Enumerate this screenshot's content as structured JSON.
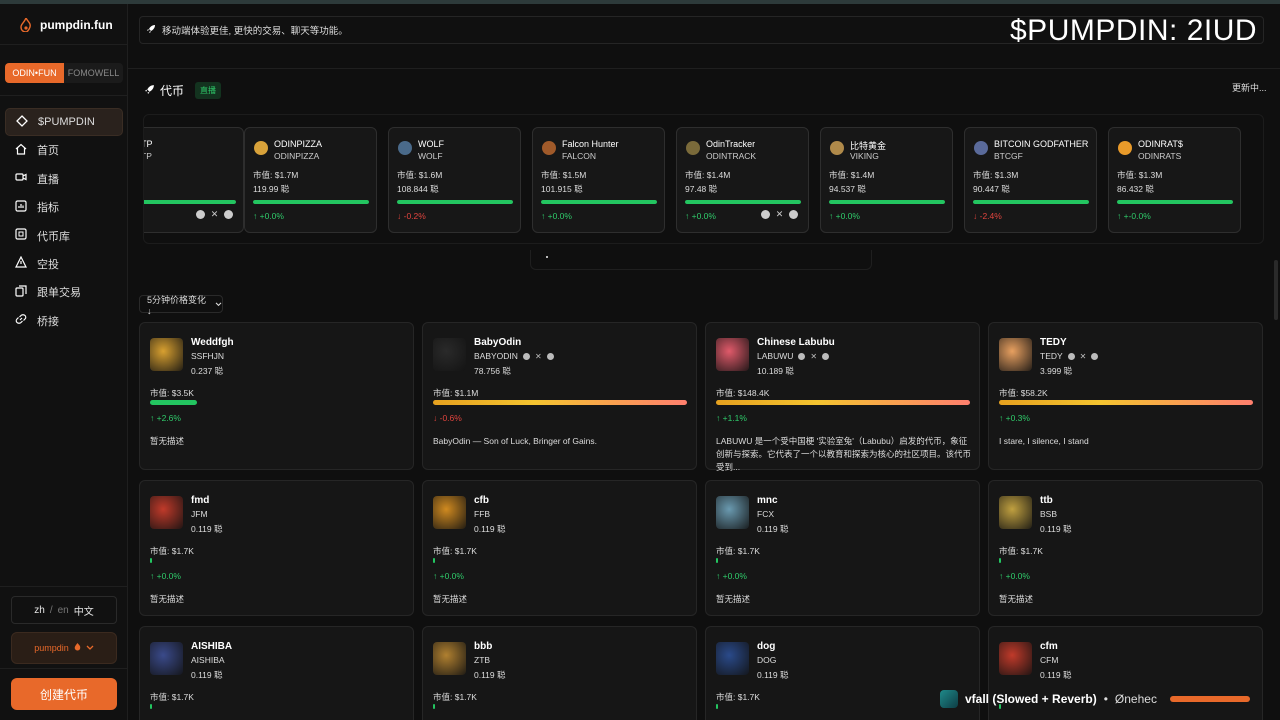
{
  "app": {
    "name": "pumpdin.fun"
  },
  "switcher": {
    "active": "ODIN•FUN",
    "inactive": "FOMOWELL"
  },
  "nav": [
    {
      "label": "$PUMPDIN",
      "icon": "diamond-icon",
      "active": true
    },
    {
      "label": "首页",
      "icon": "home-icon"
    },
    {
      "label": "直播",
      "icon": "video-icon"
    },
    {
      "label": "指标",
      "icon": "chart-icon"
    },
    {
      "label": "代币库",
      "icon": "library-icon"
    },
    {
      "label": "空投",
      "icon": "airdrop-icon"
    },
    {
      "label": "跟单交易",
      "icon": "copy-trade-icon"
    },
    {
      "label": "桥接",
      "icon": "link-icon"
    }
  ],
  "lang": {
    "zh": "zh",
    "slash": "/",
    "en": "en",
    "label": "中文"
  },
  "user": {
    "name": "pumpdin"
  },
  "create_button": "创建代币",
  "banner": {
    "text": "移动端体验更佳, 更快的交易、聊天等功能。"
  },
  "watermark": "$PUMPDIN: 2IUD",
  "tokens_section": {
    "title": "代币",
    "live": "直播",
    "updating": "更新中..."
  },
  "ticker": [
    {
      "name": "TP",
      "sym": "TP",
      "cap": "M",
      "count": "",
      "change": "",
      "dir": "up",
      "bar": 1.0,
      "socials": true,
      "color": "#777"
    },
    {
      "name": "ODINPIZZA",
      "sym": "ODINPIZZA",
      "cap": "市值: $1.7M",
      "count": "119.99 聪",
      "change": "↑ +0.0%",
      "dir": "up",
      "bar": 1.0,
      "socials": false,
      "color": "#d8a23a"
    },
    {
      "name": "WOLF",
      "sym": "WOLF",
      "cap": "市值: $1.6M",
      "count": "108.844 聪",
      "change": "↓ -0.2%",
      "dir": "down",
      "bar": 1.0,
      "socials": false,
      "color": "#4a6a8a"
    },
    {
      "name": "Falcon Hunter",
      "sym": "FALCON",
      "cap": "市值: $1.5M",
      "count": "101.915 聪",
      "change": "↑ +0.0%",
      "dir": "up",
      "bar": 1.0,
      "socials": false,
      "color": "#a05a2a"
    },
    {
      "name": "OdinTracker",
      "sym": "ODINTRACK",
      "cap": "市值: $1.4M",
      "count": "97.48 聪",
      "change": "↑ +0.0%",
      "dir": "up",
      "bar": 1.0,
      "socials": true,
      "color": "#7a6a3a"
    },
    {
      "name": "比特黄金",
      "sym": "VIKING",
      "cap": "市值: $1.4M",
      "count": "94.537 聪",
      "change": "↑ +0.0%",
      "dir": "up",
      "bar": 1.0,
      "socials": false,
      "color": "#b08a4a"
    },
    {
      "name": "BITCOIN GODFATHER",
      "sym": "BTCGF",
      "cap": "市值: $1.3M",
      "count": "90.447 聪",
      "change": "↓ -2.4%",
      "dir": "down",
      "bar": 1.0,
      "socials": false,
      "color": "#5a6a9a"
    },
    {
      "name": "ODINRAT$",
      "sym": "ODINRATS",
      "cap": "市值: $1.3M",
      "count": "86.432 聪",
      "change": "↑ +-0.0%",
      "dir": "up",
      "bar": 1.0,
      "socials": false,
      "color": "#e89a2a"
    }
  ],
  "sort": {
    "label": "5分钟价格变化↓"
  },
  "cards": [
    {
      "name": "Weddfgh",
      "sym": "SSFHJN",
      "count": "0.237 聪",
      "cap": "市值: $3.5K",
      "change": "↑ +2.6%",
      "dir": "up",
      "desc": "暂无描述",
      "bar": "green-short",
      "color": "#d8a030",
      "socials": false
    },
    {
      "name": "BabyOdin",
      "sym": "BABYODIN",
      "count": "78.756 聪",
      "cap": "市值: $1.1M",
      "change": "↓ -0.6%",
      "dir": "down",
      "desc": "BabyOdin — Son of Luck, Bringer of Gains.",
      "bar": "gradient",
      "color": "#2a2a2a",
      "socials": true
    },
    {
      "name": "Chinese Labubu",
      "sym": "LABUWU",
      "count": "10.189 聪",
      "cap": "市值: $148.4K",
      "change": "↑ +1.1%",
      "dir": "up",
      "desc": "LABUWU 是一个受中国梗 '实验室兔'（Labubu）启发的代币，象征创新与探索。它代表了一个以教育和探索为核心的社区项目。该代币受到...",
      "bar": "gradient",
      "color": "#e05a6a",
      "socials": true
    },
    {
      "name": "TEDY",
      "sym": "TEDY",
      "count": "3.999 聪",
      "cap": "市值: $58.2K",
      "change": "↑ +0.3%",
      "dir": "up",
      "desc": "I stare, I silence, I stand",
      "bar": "gradient",
      "color": "#e8a060",
      "socials": true
    },
    {
      "name": "fmd",
      "sym": "JFM",
      "count": "0.119 聪",
      "cap": "市值: $1.7K",
      "change": "↑ +0.0%",
      "dir": "up",
      "desc": "暂无描述",
      "bar": "tick",
      "color": "#c03a2a",
      "socials": false
    },
    {
      "name": "cfb",
      "sym": "FFB",
      "count": "0.119 聪",
      "cap": "市值: $1.7K",
      "change": "↑ +0.0%",
      "dir": "up",
      "desc": "暂无描述",
      "bar": "tick",
      "color": "#d08a20",
      "socials": false
    },
    {
      "name": "mnc",
      "sym": "FCX",
      "count": "0.119 聪",
      "cap": "市值: $1.7K",
      "change": "↑ +0.0%",
      "dir": "up",
      "desc": "暂无描述",
      "bar": "tick",
      "color": "#6a9ab0",
      "socials": false
    },
    {
      "name": "ttb",
      "sym": "BSB",
      "count": "0.119 聪",
      "cap": "市值: $1.7K",
      "change": "↑ +0.0%",
      "dir": "up",
      "desc": "暂无描述",
      "bar": "tick",
      "color": "#c0a040",
      "socials": false
    },
    {
      "name": "AISHIBA",
      "sym": "AISHIBA",
      "count": "0.119 聪",
      "cap": "市值: $1.7K",
      "change": "",
      "dir": "up",
      "desc": "",
      "bar": "tick",
      "color": "#3a4a8a",
      "socials": false
    },
    {
      "name": "bbb",
      "sym": "ZTB",
      "count": "0.119 聪",
      "cap": "市值: $1.7K",
      "change": "",
      "dir": "up",
      "desc": "",
      "bar": "tick",
      "color": "#b08030",
      "socials": false
    },
    {
      "name": "dog",
      "sym": "DOG",
      "count": "0.119 聪",
      "cap": "市值: $1.7K",
      "change": "",
      "dir": "up",
      "desc": "",
      "bar": "tick",
      "color": "#2a4a8a",
      "socials": false
    },
    {
      "name": "cfm",
      "sym": "CFM",
      "count": "0.119 聪",
      "cap": "",
      "change": "",
      "dir": "up",
      "desc": "",
      "bar": "tick",
      "color": "#c03a2a",
      "socials": false
    }
  ],
  "player": {
    "song": "vfall (Slowed + Reverb)",
    "sep": "•",
    "artist": "Ønehec"
  },
  "colors": {
    "accent": "#e8692a",
    "up": "#2fca6a",
    "down": "#e0443e"
  }
}
